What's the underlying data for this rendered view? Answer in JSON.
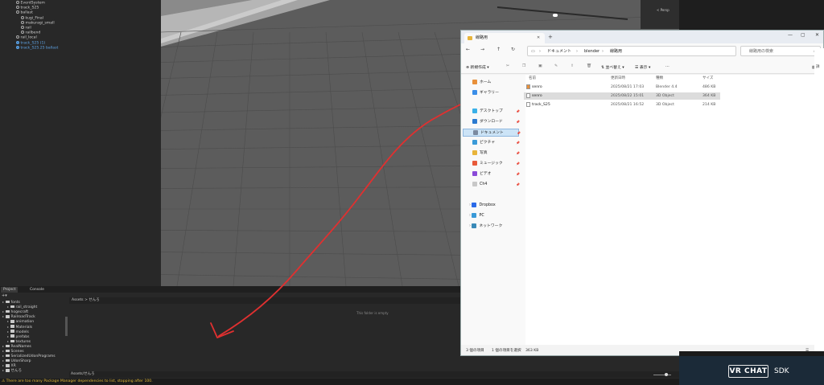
{
  "unity": {
    "hierarchy": [
      {
        "label": "EventSystem",
        "indent": 1
      },
      {
        "label": "track_S25",
        "indent": 1
      },
      {
        "label": "ballast",
        "indent": 1
      },
      {
        "label": "kugi_Final",
        "indent": 2
      },
      {
        "label": "makuragi_small",
        "indent": 2
      },
      {
        "label": "rail",
        "indent": 2
      },
      {
        "label": "railbend",
        "indent": 2
      },
      {
        "label": "rail_local",
        "indent": 1
      },
      {
        "label": "track_S25 (1)",
        "indent": 1,
        "blue": true
      },
      {
        "label": "track_S25.25 ballast",
        "indent": 1,
        "blue": true
      }
    ],
    "scene_gizmo_label": "< Persp",
    "tabs": {
      "project": "Project",
      "console": "Console"
    },
    "project_tree": [
      {
        "label": "fonts",
        "indent": 0
      },
      {
        "label": "rail_straight",
        "indent": 1
      },
      {
        "label": "hogecraft",
        "indent": 0
      },
      {
        "label": "RailroadTrack",
        "indent": 0
      },
      {
        "label": "animation",
        "indent": 1
      },
      {
        "label": "Materials",
        "indent": 1
      },
      {
        "label": "models",
        "indent": 1
      },
      {
        "label": "prefabs",
        "indent": 1
      },
      {
        "label": "textures",
        "indent": 1
      },
      {
        "label": "RealNames",
        "indent": 0
      },
      {
        "label": "Scenes",
        "indent": 0
      },
      {
        "label": "SerializedUdonPrograms",
        "indent": 0
      },
      {
        "label": "UdonSharp",
        "indent": 0
      },
      {
        "label": "XR",
        "indent": 0
      },
      {
        "label": "せんろ",
        "indent": 0
      }
    ],
    "breadcrumb": "Assets > せんろ",
    "empty_msg": "This folder is empty",
    "bottom_path": "Assets/せんろ",
    "warning": "There are too many Package Manager dependencies to list, stopping after 100."
  },
  "explorer": {
    "tab_title": "線路用",
    "address": [
      "ドキュメント",
      "blender",
      "線路用"
    ],
    "search_placeholder": "線路用の検索",
    "commands": {
      "new": "新規作成",
      "sort": "並べ替え",
      "view": "表示",
      "more": "…",
      "details": "詳細"
    },
    "sidebar": [
      {
        "label": "ホーム",
        "color": "#e8903a",
        "pin": false
      },
      {
        "label": "ギャラリー",
        "color": "#3a8ee8",
        "pin": false
      },
      {
        "label": "デスクトップ",
        "color": "#3ab0e8",
        "pin": true
      },
      {
        "label": "ダウンロード",
        "color": "#2a7ad0",
        "pin": true
      },
      {
        "label": "ドキュメント",
        "color": "#7a8aa0",
        "pin": true,
        "selected": true
      },
      {
        "label": "ピクチャ",
        "color": "#3a9ad8",
        "pin": true
      },
      {
        "label": "写真",
        "color": "#e8b43a",
        "pin": true
      },
      {
        "label": "ミュージック",
        "color": "#e85a3a",
        "pin": true
      },
      {
        "label": "ビデオ",
        "color": "#8a4ad8",
        "pin": true
      },
      {
        "label": "Ch4",
        "color": "#c8c8c8",
        "pin": true
      },
      {
        "label": "Dropbox",
        "color": "#2a6ae8",
        "pin": false
      },
      {
        "label": "PC",
        "color": "#3a9ad8",
        "pin": false
      },
      {
        "label": "ネットワーク",
        "color": "#3a8ab8",
        "pin": false
      }
    ],
    "columns": {
      "name": "名前",
      "date": "更新日時",
      "type": "種類",
      "size": "サイズ"
    },
    "files": [
      {
        "name": "senro",
        "date": "2025/08/21 17:03",
        "type": "Blender 4.4",
        "size": "486 KB",
        "icon_color": "#e8903a",
        "selected": false
      },
      {
        "name": "senro",
        "date": "2025/08/22 15:01",
        "type": "3D Object",
        "size": "364 KB",
        "icon_color": "#ffffff",
        "selected": true
      },
      {
        "name": "track_S25",
        "date": "2025/08/21 16:52",
        "type": "3D Object",
        "size": "214 KB",
        "icon_color": "#ffffff",
        "selected": false
      }
    ],
    "status": {
      "count": "3 個の項目",
      "selected": "1 個の項目を選択",
      "size": "363 KB"
    }
  },
  "vrchat": {
    "logo": "VR CHAT",
    "sdk": "SDK"
  }
}
